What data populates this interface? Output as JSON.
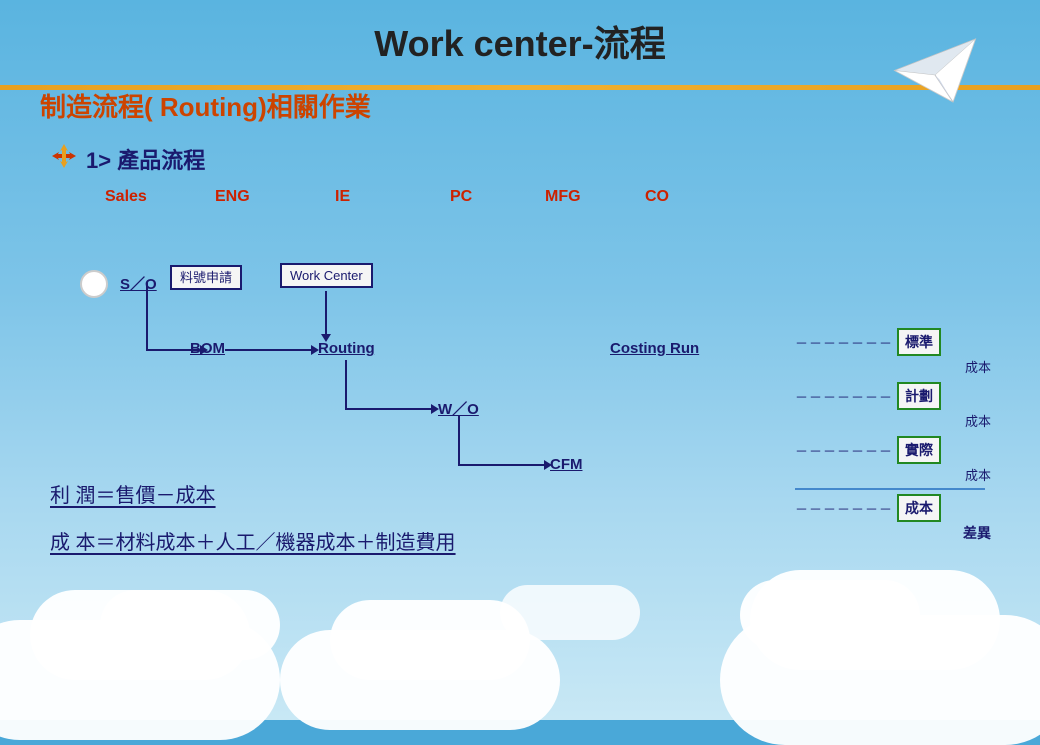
{
  "title": {
    "main": "Work center-流程",
    "main_en": "Work center-",
    "main_zh": "流程"
  },
  "section": {
    "header": "制造流程( Routing)相關作業",
    "product_flow": "1> 產品流程"
  },
  "columns": {
    "headers": [
      "Sales",
      "ENG",
      "IE",
      "PC",
      "MFG",
      "CO"
    ]
  },
  "flow": {
    "so": "S／O",
    "material_request": "料號申請",
    "work_center": "Work  Center",
    "bom": "BOM",
    "routing": "Routing",
    "wo": "W／O",
    "cfm": "CFM",
    "costing_run": "Costing  Run"
  },
  "cost": {
    "standard_label": "標準",
    "standard_sub": "成本",
    "plan_label": "計劃",
    "plan_sub": "成本",
    "actual_label": "實際",
    "actual_sub": "成本",
    "diff_label": "成本",
    "diff_sub": "差異",
    "dashes": "－－－－－－－"
  },
  "formulas": {
    "profit": "利 潤＝售價－成本",
    "cost": "成 本＝材料成本＋人工／機器成本＋制造費用"
  },
  "colors": {
    "sky_blue": "#5ab4e0",
    "dark_blue": "#1a1a6e",
    "red_header": "#cc2200",
    "orange": "#e8a020",
    "green_border": "#228822",
    "text_blue": "#4488cc"
  }
}
